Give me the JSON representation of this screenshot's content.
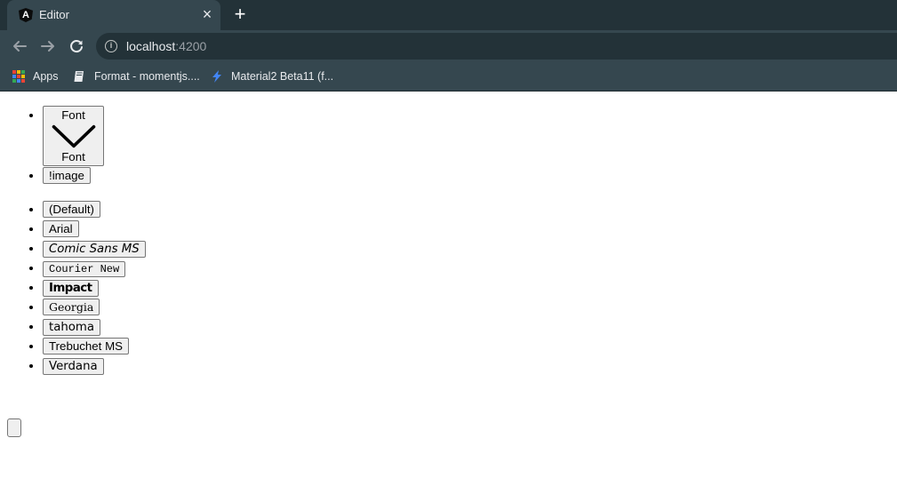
{
  "browser": {
    "tab": {
      "title": "Editor",
      "favicon": "angular-icon",
      "favicon_glyph": "A"
    },
    "new_tab_label": "+",
    "close_label": "×",
    "url": {
      "host": "localhost",
      "port": ":4200"
    },
    "bookmarks": [
      {
        "label": "Apps",
        "icon": "apps-grid-icon"
      },
      {
        "label": "Format - momentjs....",
        "icon": "book-icon"
      },
      {
        "label": "Material2 Beta11 (f...",
        "icon": "lightning-icon"
      }
    ]
  },
  "page": {
    "toolbar": {
      "font_button": {
        "label_top": "Font",
        "label_bottom": "Font",
        "icon": "chevron-down-icon"
      },
      "image_button": {
        "label": "!image"
      }
    },
    "font_options": [
      "(Default)",
      "Arial",
      "Comic Sans MS",
      "Courier New",
      "Impact",
      "Georgia",
      "tahoma",
      "Trebuchet MS",
      "Verdana"
    ]
  },
  "colors": {
    "tabstrip": "#233238",
    "toolbar": "#35474f",
    "text_light": "#e8eaed"
  }
}
